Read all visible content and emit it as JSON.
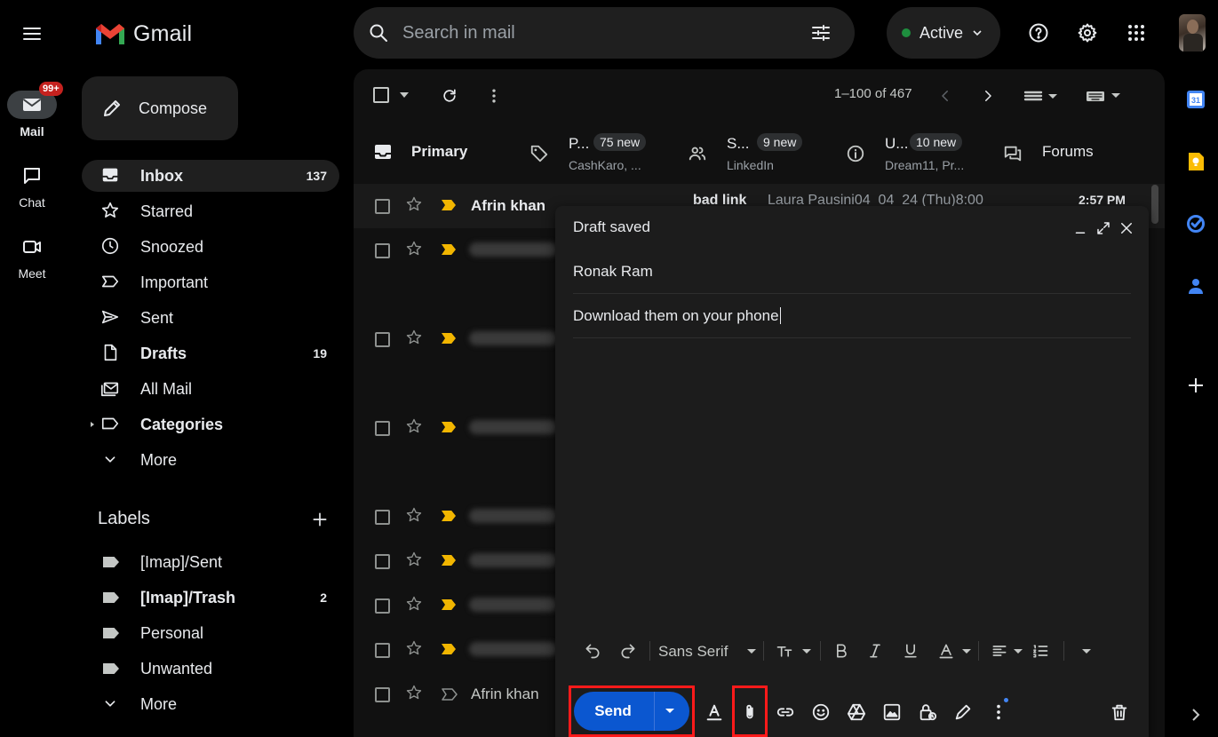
{
  "header": {
    "app_name": "Gmail",
    "search_placeholder": "Search in mail",
    "status_label": "Active",
    "status_color": "#1e8e3e"
  },
  "rail": {
    "items": [
      {
        "label": "Mail",
        "icon": "mail-icon",
        "badge": "99+"
      },
      {
        "label": "Chat",
        "icon": "chat-icon"
      },
      {
        "label": "Meet",
        "icon": "video-icon"
      }
    ]
  },
  "compose_label": "Compose",
  "nav": {
    "items": [
      {
        "label": "Inbox",
        "count": "137",
        "icon": "inbox-icon"
      },
      {
        "label": "Starred",
        "icon": "star-icon"
      },
      {
        "label": "Snoozed",
        "icon": "clock-icon"
      },
      {
        "label": "Important",
        "icon": "important-icon"
      },
      {
        "label": "Sent",
        "icon": "send-icon"
      },
      {
        "label": "Drafts",
        "count": "19",
        "icon": "draft-icon"
      },
      {
        "label": "All Mail",
        "icon": "all-mail-icon"
      },
      {
        "label": "Categories",
        "icon": "label-icon"
      },
      {
        "label": "More",
        "icon": "chevron-down-icon"
      }
    ]
  },
  "labels": {
    "heading": "Labels",
    "items": [
      {
        "label": "[Imap]/Sent"
      },
      {
        "label": "[Imap]/Trash",
        "count": "2"
      },
      {
        "label": "Personal"
      },
      {
        "label": "Unwanted"
      }
    ],
    "more": "More"
  },
  "toolbar": {
    "pagination": "1–100 of 467"
  },
  "tabs": [
    {
      "label": "Primary"
    },
    {
      "label": "P...",
      "badge": "75 new",
      "sub": "CashKaro, ..."
    },
    {
      "label": "S...",
      "badge": "9 new",
      "sub": "LinkedIn"
    },
    {
      "label": "U...",
      "badge": "10 new",
      "sub": "Dream11, Pr..."
    },
    {
      "label": "Forums"
    }
  ],
  "emails": [
    {
      "sender": "Afrin khan",
      "subject": "bad link",
      "snippet": "Laura Pausini04_04_24 (Thu)8:00",
      "time": "2:57 PM",
      "unread": true,
      "important": true
    },
    {
      "sender": "",
      "important": true
    },
    {
      "sender": "",
      "important": true
    },
    {
      "sender": "",
      "important": true
    },
    {
      "sender": "",
      "important": true
    },
    {
      "sender": "",
      "important": true
    },
    {
      "sender": "",
      "important": true
    },
    {
      "sender": "",
      "important": true
    },
    {
      "sender": "Afrin khan",
      "important": false
    }
  ],
  "compose_window": {
    "title": "Draft saved",
    "to": "Ronak Ram",
    "subject": "Download them on your phone",
    "font": "Sans Serif",
    "send_label": "Send"
  },
  "highlight_color": "#ff1a1a",
  "send_color": "#0b57d0"
}
